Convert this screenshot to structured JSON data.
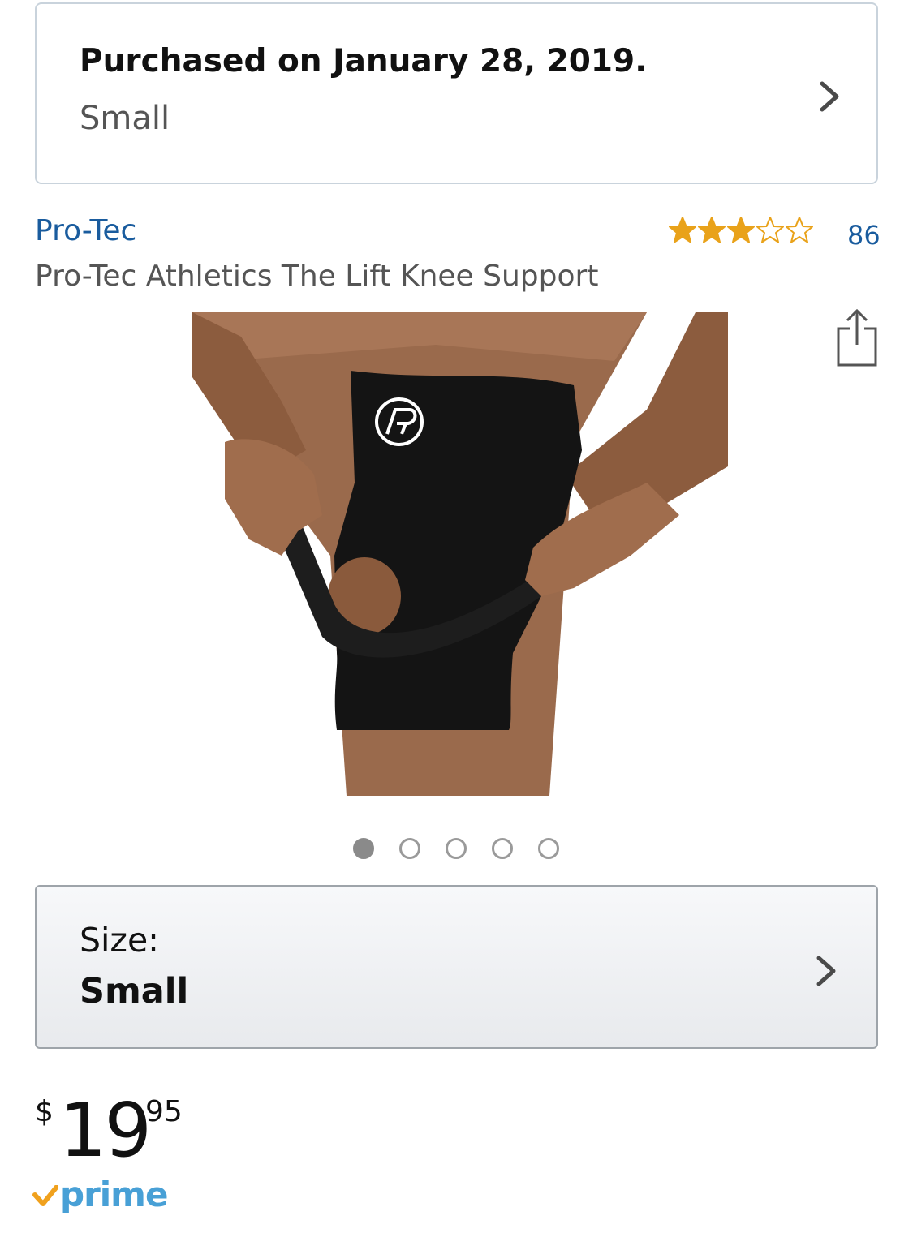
{
  "purchase": {
    "text": "Purchased on January 28, 2019.",
    "variant": "Small"
  },
  "product": {
    "brand": "Pro-Tec",
    "title": "Pro-Tec Athletics The Lift Knee Support",
    "rating_stars": 3,
    "rating_max": 5,
    "rating_count": "86",
    "image_description": "knee-brace-photo"
  },
  "carousel": {
    "count": 5,
    "active_index": 0
  },
  "size": {
    "label": "Size:",
    "value": "Small"
  },
  "price": {
    "currency": "$",
    "whole": "19",
    "fraction": "95"
  },
  "prime": {
    "label": "prime"
  },
  "colors": {
    "link": "#1a5c9e",
    "star": "#e9a21a",
    "prime_check": "#f0a11d",
    "prime_text": "#48a0d6"
  }
}
